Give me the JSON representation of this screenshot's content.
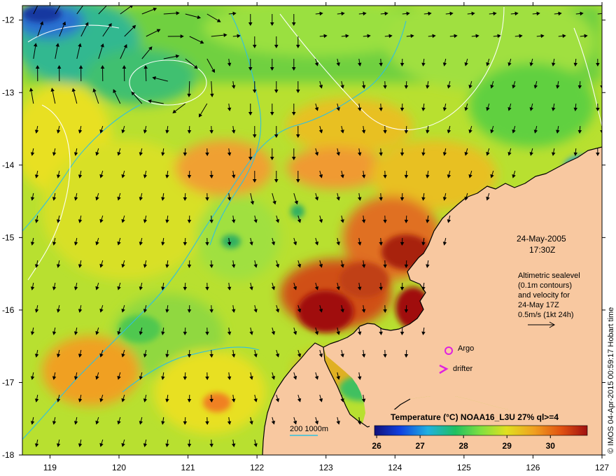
{
  "date_label": "24-May-2005",
  "time_label": "17:30Z",
  "info_lines": [
    "Altimetric sealevel",
    "(0.1m contours)",
    "and velocity for",
    "24-May 17Z",
    "0.5m/s (1kt 24h)"
  ],
  "legend": {
    "argo_label": "Argo",
    "drifter_label": "drifter",
    "argo_color": "#e020e0",
    "drifter_color": "#e020e0"
  },
  "colorbar": {
    "title": "Temperature (°C) NOAA16_L3U 27% ql>=4",
    "ticks": [
      "26",
      "27",
      "28",
      "29",
      "30"
    ]
  },
  "scale_bar_label": "200  1000m",
  "credit": "© IMOS 04-Apr-2015 00:59:17 Hobart time",
  "axes": {
    "x_ticks": [
      "119",
      "120",
      "121",
      "122",
      "123",
      "124",
      "125",
      "126",
      "127"
    ],
    "y_ticks": [
      "-12",
      "-13",
      "-14",
      "-15",
      "-16",
      "-17",
      "-18"
    ],
    "x_range": [
      118.6,
      127
    ],
    "y_range": [
      -18,
      -11.8
    ]
  },
  "colors": {
    "land": "#f8c8a0",
    "coastline": "#000000",
    "isobath": "#30c0e0",
    "contour": "#ffffff",
    "palette": [
      "#10107a",
      "#1040e0",
      "#20b0e0",
      "#20c060",
      "#80e040",
      "#e0e020",
      "#f0a020",
      "#e05010",
      "#a01010"
    ]
  }
}
